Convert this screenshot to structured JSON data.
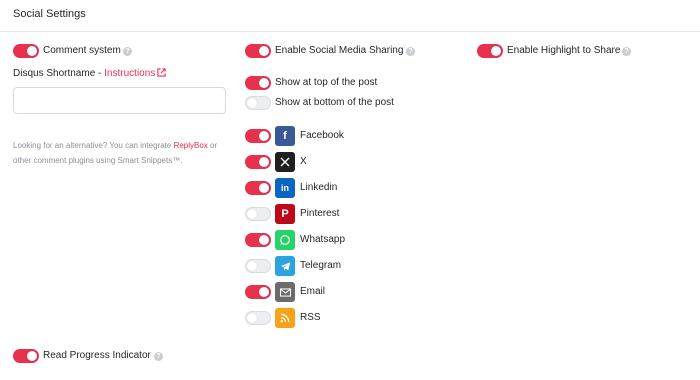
{
  "header": {
    "title": "Social Settings"
  },
  "comment": {
    "label": "Comment system",
    "shortname_label": "Disqus Shortname - ",
    "shortname_link": "Instructions",
    "shortname_value": "",
    "hint_before": "Looking for an alternative? You can integrate ",
    "hint_link": "ReplyBox",
    "hint_after": " or other comment plugins using Smart Snippets™."
  },
  "sharing": {
    "label": "Enable Social Media Sharing",
    "top_label": "Show at top of the post",
    "bottom_label": "Show at bottom of the post",
    "networks": [
      {
        "name": "Facebook",
        "enabled": true,
        "icon": "facebook-icon",
        "color": "#3b5998"
      },
      {
        "name": "X",
        "enabled": true,
        "icon": "x-icon",
        "color": "#1f1f1f"
      },
      {
        "name": "Linkedin",
        "enabled": true,
        "icon": "linkedin-icon",
        "color": "#0a66c2"
      },
      {
        "name": "Pinterest",
        "enabled": false,
        "icon": "pinterest-icon",
        "color": "#bd081c"
      },
      {
        "name": "Whatsapp",
        "enabled": true,
        "icon": "whatsapp-icon",
        "color": "#25d366"
      },
      {
        "name": "Telegram",
        "enabled": false,
        "icon": "telegram-icon",
        "color": "#2aa3e0"
      },
      {
        "name": "Email",
        "enabled": true,
        "icon": "email-icon",
        "color": "#6b6b6b"
      },
      {
        "name": "RSS",
        "enabled": false,
        "icon": "rss-icon",
        "color": "#f7a21a"
      }
    ]
  },
  "highlight": {
    "label": "Enable Highlight to Share"
  },
  "progress": {
    "label": "Read Progress Indicator"
  },
  "colors": {
    "accent": "#e8304f",
    "toggle_off": "#eceef1"
  }
}
